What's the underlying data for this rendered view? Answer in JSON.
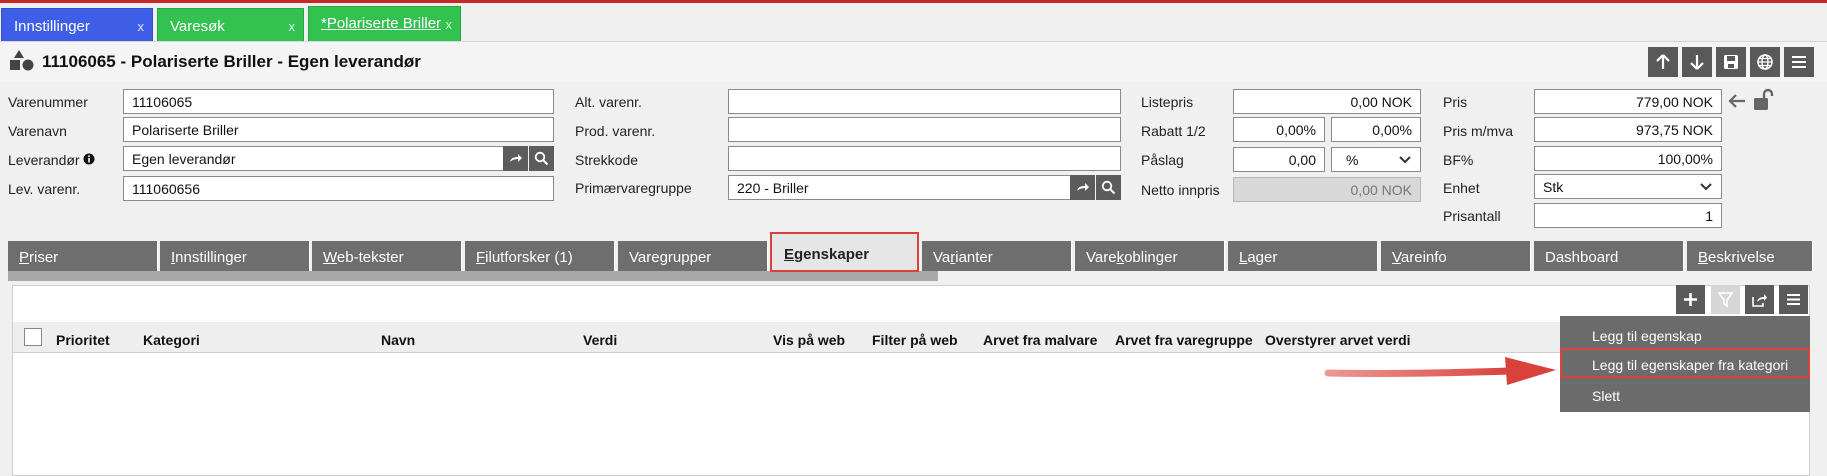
{
  "tabs_top": [
    {
      "label": "Innstillinger",
      "close": "x"
    },
    {
      "label": "Varesøk",
      "close": "x"
    },
    {
      "label": "*Polariserte Briller",
      "close": "x"
    }
  ],
  "header": {
    "title": "11106065 - Polariserte Briller - Egen leverandør"
  },
  "toolbar": {
    "icons": [
      "arrow-up-icon",
      "arrow-down-icon",
      "save-icon",
      "globe-icon",
      "menu-icon"
    ]
  },
  "form": {
    "col1": {
      "varenummer_label": "Varenummer",
      "varenummer_value": "11106065",
      "varenavn_label": "Varenavn",
      "varenavn_value": "Polariserte Briller",
      "leverandor_label": "Leverandør",
      "leverandor_value": "Egen leverandør",
      "levvarenr_label": "Lev. varenr.",
      "levvarenr_value": "111060656"
    },
    "col2": {
      "altvarenr_label": "Alt. varenr.",
      "altvarenr_value": "",
      "prodvarenr_label": "Prod. varenr.",
      "prodvarenr_value": "",
      "strekkode_label": "Strekkode",
      "strekkode_value": "",
      "primaervaregruppe_label": "Primærvaregruppe",
      "primaervaregruppe_value": "220 - Briller"
    },
    "col3": {
      "listepris_label": "Listepris",
      "listepris_value": "0,00 NOK",
      "rabatt_label": "Rabatt 1/2",
      "rabatt1_value": "0,00%",
      "rabatt2_value": "0,00%",
      "paslag_label": "Påslag",
      "paslag_value": "0,00",
      "paslag_unit": "%",
      "nettoinnpris_label": "Netto innpris",
      "nettoinnpris_value": "0,00 NOK"
    },
    "col4": {
      "pris_label": "Pris",
      "pris_value": "779,00 NOK",
      "prismva_label": "Pris m/mva",
      "prismva_value": "973,75 NOK",
      "bf_label": "BF%",
      "bf_value": "100,00%",
      "enhet_label": "Enhet",
      "enhet_value": "Stk",
      "prisantall_label": "Prisantall",
      "prisantall_value": "1"
    }
  },
  "tabs": [
    {
      "pre": "",
      "ul": "P",
      "post": "riser"
    },
    {
      "pre": "",
      "ul": "I",
      "post": "nnstillinger"
    },
    {
      "pre": "",
      "ul": "W",
      "post": "eb-tekster"
    },
    {
      "pre": "",
      "ul": "F",
      "post": "ilutforsker (1)"
    },
    {
      "pre": "Vare",
      "ul": "g",
      "post": "rupper"
    },
    {
      "pre": "",
      "ul": "E",
      "post": "genskaper"
    },
    {
      "pre": "Va",
      "ul": "r",
      "post": "ianter"
    },
    {
      "pre": "Vare",
      "ul": "k",
      "post": "oblinger"
    },
    {
      "pre": "",
      "ul": "L",
      "post": "ager"
    },
    {
      "pre": "",
      "ul": "V",
      "post": "areinfo"
    },
    {
      "pre": "",
      "ul": "",
      "post": "Dashboard"
    },
    {
      "pre": "",
      "ul": "B",
      "post": "eskrivelse"
    }
  ],
  "grid": {
    "columns": [
      "Prioritet",
      "Kategori",
      "Navn",
      "Verdi",
      "Vis på web",
      "Filter på web",
      "Arvet fra malvare",
      "Arvet fra varegruppe",
      "Overstyrer arvet verdi"
    ]
  },
  "menu": {
    "items": [
      "Legg til egenskap",
      "Legg til egenskaper fra kategori",
      "Slett"
    ]
  },
  "colors": {
    "accent_red": "#d9413b",
    "tab_blue": "#3f5ee8",
    "tab_green": "#33c250",
    "tab_gray": "#6e6e6e"
  }
}
